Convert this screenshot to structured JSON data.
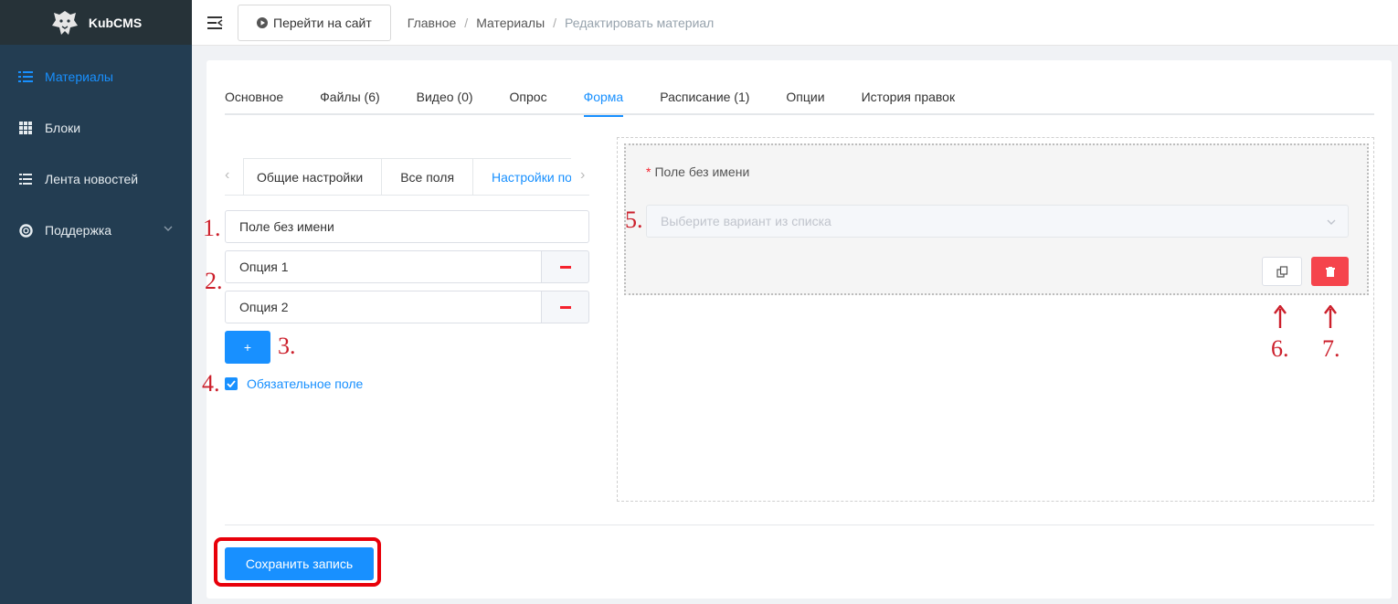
{
  "brand": {
    "name": "KubCMS"
  },
  "sidebar": {
    "items": [
      {
        "label": "Материалы",
        "icon": "list-icon",
        "active": true
      },
      {
        "label": "Блоки",
        "icon": "grid-icon",
        "active": false
      },
      {
        "label": "Лента новостей",
        "icon": "feed-icon",
        "active": false
      },
      {
        "label": "Поддержка",
        "icon": "lifebuoy-icon",
        "active": false
      }
    ]
  },
  "header": {
    "site_button": "Перейти на сайт",
    "breadcrumb": [
      "Главное",
      "Материалы",
      "Редактировать материал"
    ],
    "separator": "/"
  },
  "tabs": [
    "Основное",
    "Файлы (6)",
    "Видео (0)",
    "Опрос",
    "Форма",
    "Расписание (1)",
    "Опции",
    "История правок"
  ],
  "active_tab": "Форма",
  "subtabs": [
    "Общие настройки",
    "Все поля",
    "Настройки по"
  ],
  "editor": {
    "field_name": "Поле без имени",
    "options": [
      "Опция 1",
      "Опция 2"
    ],
    "add_label": "+",
    "required_label": "Обязательное поле",
    "required_checked": true
  },
  "preview": {
    "required_mark": "*",
    "label": "Поле без имени",
    "select_placeholder": "Выберите вариант из списка"
  },
  "save_label": "Сохранить запись",
  "annotations": [
    "1.",
    "2.",
    "3.",
    "4.",
    "5.",
    "6.",
    "7."
  ],
  "colors": {
    "accent": "#1890ff",
    "sidebar": "#233d52",
    "danger": "#f5444c",
    "annotation": "#cc1f2b"
  }
}
